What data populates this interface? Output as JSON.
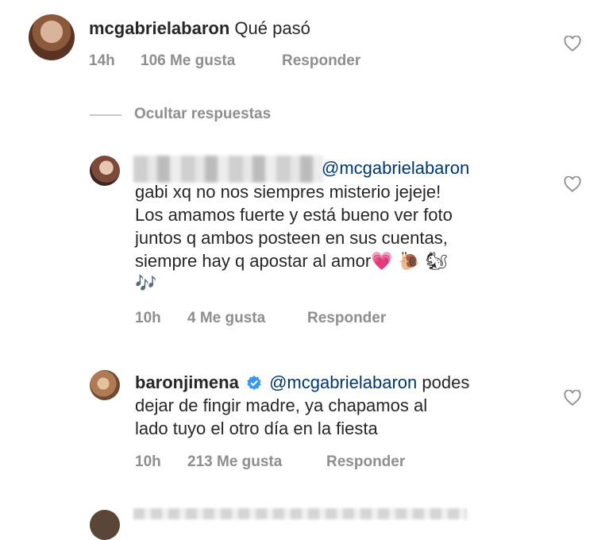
{
  "comment": {
    "username": "mcgabrielabaron",
    "text": "Qué pasó",
    "time": "14h",
    "likes": "106 Me gusta",
    "reply_label": "Responder",
    "avatar_icon": "profile-photo-icon"
  },
  "hide_replies_label": "Ocultar respuestas",
  "replies": [
    {
      "username": "",
      "mention": "@mcgabrielabaron",
      "lines": [
        "gabi xq no nos siempres misterio jejeje!",
        "Los amamos fuerte y está bueno ver foto",
        "juntos q ambos posteen en  sus cuentas,",
        "siempre hay q apostar al amor"
      ],
      "emojis_line4": "💗 🐌 🐿",
      "emojis_line5": "🎶",
      "time": "10h",
      "likes": "4 Me gusta",
      "reply_label": "Responder"
    },
    {
      "username": "baronjimena",
      "verified": true,
      "mention": "@mcgabrielabaron",
      "lines": [
        "podes",
        "dejar de fingir madre, ya chapamos al",
        "lado tuyo el otro día en la fiesta"
      ],
      "time": "10h",
      "likes": "213 Me gusta",
      "reply_label": "Responder"
    }
  ],
  "colors": {
    "text": "#262626",
    "meta": "#8e8e8e",
    "mention": "#00376b",
    "verified": "#3897f0"
  }
}
